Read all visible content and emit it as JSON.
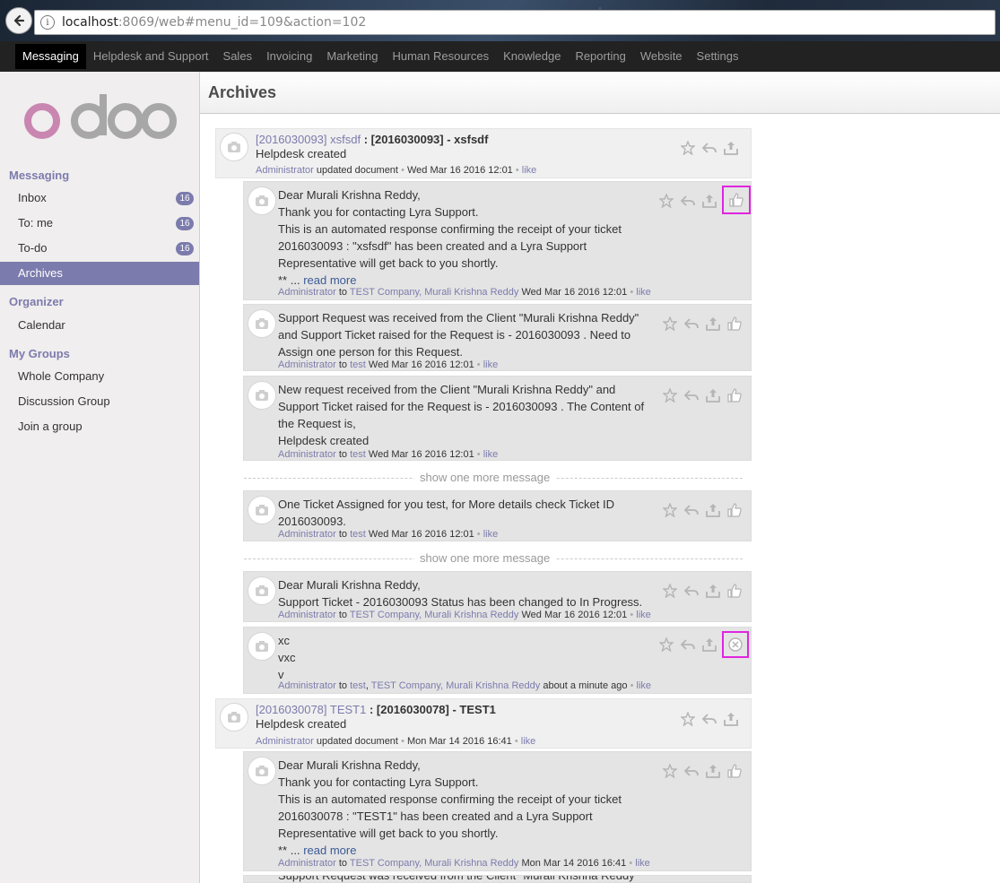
{
  "browser": {
    "url_host": "localhost",
    "url_rest": ":8069/web#menu_id=109&action=102"
  },
  "topnav": [
    "Messaging",
    "Helpdesk and Support",
    "Sales",
    "Invoicing",
    "Marketing",
    "Human Resources",
    "Knowledge",
    "Reporting",
    "Website",
    "Settings"
  ],
  "sidebar": {
    "logo_text": "odoo",
    "messaging_label": "Messaging",
    "inbox": {
      "label": "Inbox",
      "count": "16"
    },
    "to_me": {
      "label": "To: me",
      "count": "16"
    },
    "todo": {
      "label": "To-do",
      "count": "16"
    },
    "archives": {
      "label": "Archives"
    },
    "organizer_label": "Organizer",
    "calendar": {
      "label": "Calendar"
    },
    "groups_label": "My Groups",
    "whole_company": {
      "label": "Whole Company"
    },
    "discussion": {
      "label": "Discussion Group"
    },
    "join": {
      "label": "Join a group"
    }
  },
  "page": {
    "title": "Archives"
  },
  "common": {
    "administrator": "Administrator",
    "updated_document": "updated document",
    "to": "to",
    "like": "like",
    "dot": "•",
    "read_more": "read more",
    "show_one_more": "show one more message",
    "test_company_murali": "TEST Company, Murali Krishna Reddy",
    "test": "test",
    "test_sep": "test",
    "test_company_murali2": "TEST Company, Murali Krishna Reddy",
    "ellipsis": "** ..."
  },
  "thread1": {
    "record": "[2016030093] xsfsdf",
    "subject": " : [2016030093] - xsfsdf",
    "body": "Helpdesk created",
    "date": "Wed Mar 16 2016 12:01"
  },
  "m1": {
    "lines": [
      "Dear Murali Krishna Reddy,",
      "Thank you for contacting Lyra Support.",
      "This is an automated response confirming the receipt of your ticket",
      "2016030093 : \"xsfsdf\" has been created and a Lyra Support",
      "Representative will get back to you shortly."
    ],
    "date": "Wed Mar 16 2016 12:01"
  },
  "m2": {
    "lines": [
      "Support Request was received from the Client \"Murali Krishna Reddy\"",
      "and Support Ticket raised for the Request is - 2016030093 . Need to",
      "Assign one person for this Request."
    ],
    "date": "Wed Mar 16 2016 12:01"
  },
  "m3": {
    "lines": [
      "New request received from the Client \"Murali Krishna Reddy\" and",
      "Support Ticket raised for the Request is - 2016030093 . The Content of",
      "the Request is,",
      "Helpdesk created"
    ],
    "date": "Wed Mar 16 2016 12:01"
  },
  "m4": {
    "lines": [
      "One Ticket Assigned for you test, for More details check Ticket ID",
      "2016030093."
    ],
    "date": "Wed Mar 16 2016 12:01"
  },
  "m5": {
    "lines": [
      "Dear Murali Krishna Reddy,",
      "Support Ticket - 2016030093 Status has been changed to In Progress."
    ],
    "date": "Wed Mar 16 2016 12:01"
  },
  "m6": {
    "lines": [
      "xc",
      "vxc",
      "v"
    ],
    "date": "about a minute ago"
  },
  "thread2": {
    "record": "[2016030078] TEST1",
    "subject": " : [2016030078] - TEST1",
    "body": "Helpdesk created",
    "date": "Mon Mar 14 2016 16:41"
  },
  "m7": {
    "lines": [
      "Dear Murali Krishna Reddy,",
      "Thank you for contacting Lyra Support.",
      "This is an automated response confirming the receipt of your ticket",
      "2016030078 : \"TEST1\" has been created and a Lyra Support",
      "Representative will get back to you shortly."
    ],
    "date": "Mon Mar 14 2016 16:41"
  },
  "m8": {
    "partial": "Support Request was received from the Client \"Murali Krishna Reddy\""
  }
}
